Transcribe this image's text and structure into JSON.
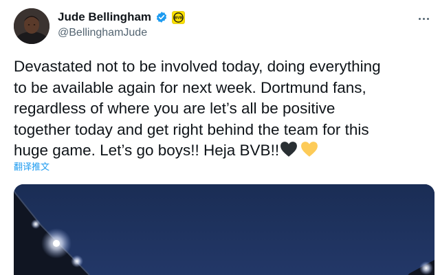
{
  "author": {
    "display_name": "Jude Bellingham",
    "handle": "@BellinghamJude"
  },
  "tweet": {
    "lines": [
      "Devastated not to be involved today, doing everything",
      "to be available again for next week. Dortmund fans,",
      "regardless of where you are let’s all be positive",
      "together today and get right behind the team for this",
      "huge game. Let’s go boys!! Heja BVB!!"
    ],
    "translate_label": "翻译推文"
  },
  "icons": {
    "verified": "verified-badge-icon",
    "affiliate": "bvb-badge-icon",
    "more": "more-options-icon",
    "emojis": [
      "black-heart-emoji",
      "yellow-heart-emoji"
    ]
  },
  "colors": {
    "link": "#1d9bf0",
    "verified": "#1d9bf0",
    "bvb_yellow": "#fde100",
    "secondary_text": "#536471"
  }
}
